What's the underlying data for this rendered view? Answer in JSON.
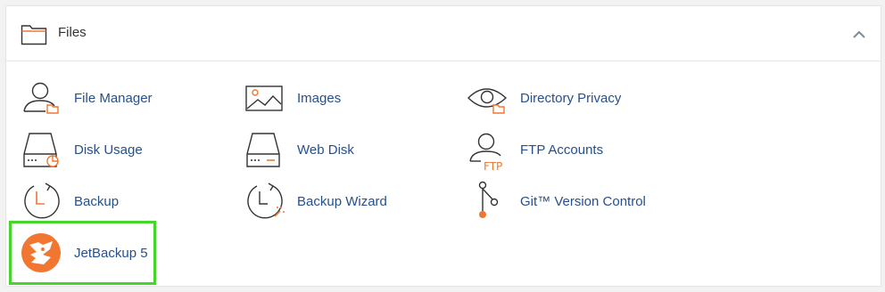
{
  "section": {
    "title": "Files"
  },
  "items": [
    {
      "label": "File Manager",
      "icon": "file-manager-icon"
    },
    {
      "label": "Images",
      "icon": "images-icon"
    },
    {
      "label": "Directory Privacy",
      "icon": "directory-privacy-icon"
    },
    {
      "label": "Disk Usage",
      "icon": "disk-usage-icon"
    },
    {
      "label": "Web Disk",
      "icon": "web-disk-icon"
    },
    {
      "label": "FTP Accounts",
      "icon": "ftp-accounts-icon"
    },
    {
      "label": "Backup",
      "icon": "backup-icon"
    },
    {
      "label": "Backup Wizard",
      "icon": "backup-wizard-icon"
    },
    {
      "label": "Git™ Version Control",
      "icon": "git-icon"
    },
    {
      "label": "JetBackup 5",
      "icon": "jetbackup-icon"
    }
  ],
  "ftp_icon_text": "FTP",
  "colors": {
    "link": "#26508c",
    "accent_orange": "#f07631",
    "icon_outline": "#333333",
    "highlight": "#45d52b"
  }
}
